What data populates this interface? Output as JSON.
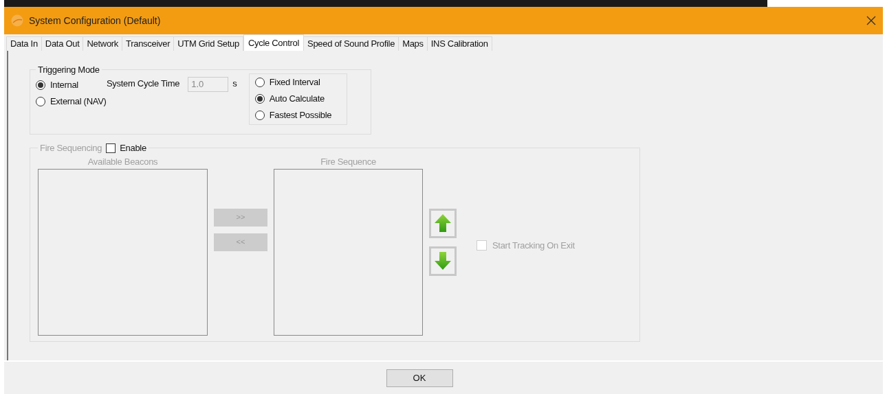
{
  "window": {
    "title": "System Configuration (Default)"
  },
  "tabs": [
    {
      "label": "Data In",
      "selected": false
    },
    {
      "label": "Data Out",
      "selected": false
    },
    {
      "label": "Network",
      "selected": false
    },
    {
      "label": "Transceiver",
      "selected": false
    },
    {
      "label": "UTM Grid Setup",
      "selected": false
    },
    {
      "label": "Cycle Control",
      "selected": true
    },
    {
      "label": "Speed of Sound Profile",
      "selected": false
    },
    {
      "label": "Maps",
      "selected": false
    },
    {
      "label": "INS Calibration",
      "selected": false
    }
  ],
  "triggering_mode": {
    "title": "Triggering Mode",
    "options": [
      {
        "label": "Internal",
        "selected": true
      },
      {
        "label": "External (NAV)",
        "selected": false
      }
    ],
    "cycle_time": {
      "label": "System Cycle Time",
      "value": "1.0",
      "unit": "s",
      "disabled": true
    },
    "interval_options": [
      {
        "label": "Fixed Interval",
        "selected": false
      },
      {
        "label": "Auto Calculate",
        "selected": true
      },
      {
        "label": "Fastest Possible",
        "selected": false
      }
    ]
  },
  "fire_sequencing": {
    "title": "Fire Sequencing",
    "enable": {
      "label": "Enable",
      "checked": false
    },
    "available_title": "Available Beacons",
    "sequence_title": "Fire Sequence",
    "add_button": ">>",
    "remove_button": "<<",
    "start_tracking": {
      "label": "Start Tracking On Exit",
      "checked": false
    }
  },
  "buttons": [
    "OK"
  ]
}
